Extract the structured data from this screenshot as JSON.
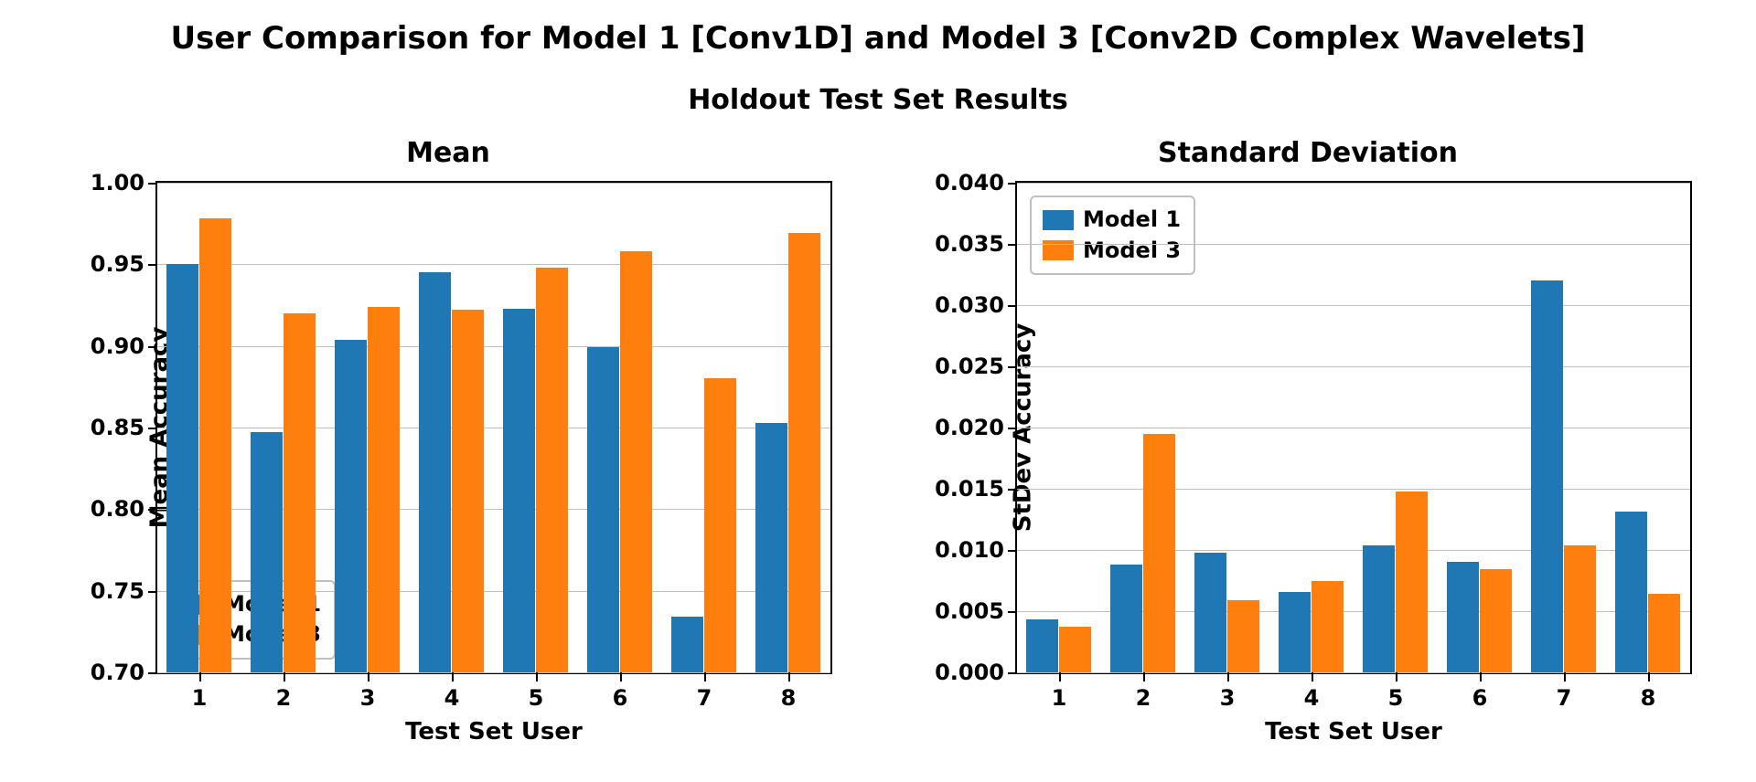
{
  "suptitle": "User Comparison for Model 1 [Conv1D] and Model 3 [Conv2D Complex Wavelets]",
  "subtitle": "Holdout Test Set Results",
  "colors": {
    "model1": "#1f77b4",
    "model3": "#ff7f0e"
  },
  "legend_labels": {
    "model1": "Model 1",
    "model3": "Model 3"
  },
  "chart_data": [
    {
      "id": "mean",
      "type": "bar",
      "title": "Mean",
      "xlabel": "Test Set User",
      "ylabel": "Mean Accuracy",
      "legend_pos": "lower-left",
      "categories": [
        "1",
        "2",
        "3",
        "4",
        "5",
        "6",
        "7",
        "8"
      ],
      "ylim": [
        0.7,
        1.0
      ],
      "yticks": [
        0.7,
        0.75,
        0.8,
        0.85,
        0.9,
        0.95,
        1.0
      ],
      "ytick_labels": [
        "0.70",
        "0.75",
        "0.80",
        "0.85",
        "0.90",
        "0.95",
        "1.00"
      ],
      "grid": true,
      "series": [
        {
          "name": "Model 1",
          "color_key": "model1",
          "values": [
            0.95,
            0.847,
            0.904,
            0.945,
            0.923,
            0.899,
            0.734,
            0.853
          ]
        },
        {
          "name": "Model 3",
          "color_key": "model3",
          "values": [
            0.978,
            0.92,
            0.924,
            0.922,
            0.948,
            0.958,
            0.88,
            0.969
          ]
        }
      ]
    },
    {
      "id": "std",
      "type": "bar",
      "title": "Standard Deviation",
      "xlabel": "Test Set User",
      "ylabel": "StDev Accuracy",
      "legend_pos": "upper-left",
      "categories": [
        "1",
        "2",
        "3",
        "4",
        "5",
        "6",
        "7",
        "8"
      ],
      "ylim": [
        0.0,
        0.04
      ],
      "yticks": [
        0.0,
        0.005,
        0.01,
        0.015,
        0.02,
        0.025,
        0.03,
        0.035,
        0.04
      ],
      "ytick_labels": [
        "0.000",
        "0.005",
        "0.010",
        "0.015",
        "0.020",
        "0.025",
        "0.030",
        "0.035",
        "0.040"
      ],
      "grid": true,
      "series": [
        {
          "name": "Model 1",
          "color_key": "model1",
          "values": [
            0.0043,
            0.0088,
            0.0098,
            0.0066,
            0.0104,
            0.009,
            0.032,
            0.0131
          ]
        },
        {
          "name": "Model 3",
          "color_key": "model3",
          "values": [
            0.0037,
            0.0195,
            0.0059,
            0.0075,
            0.0148,
            0.0084,
            0.0104,
            0.0064
          ]
        }
      ]
    }
  ]
}
